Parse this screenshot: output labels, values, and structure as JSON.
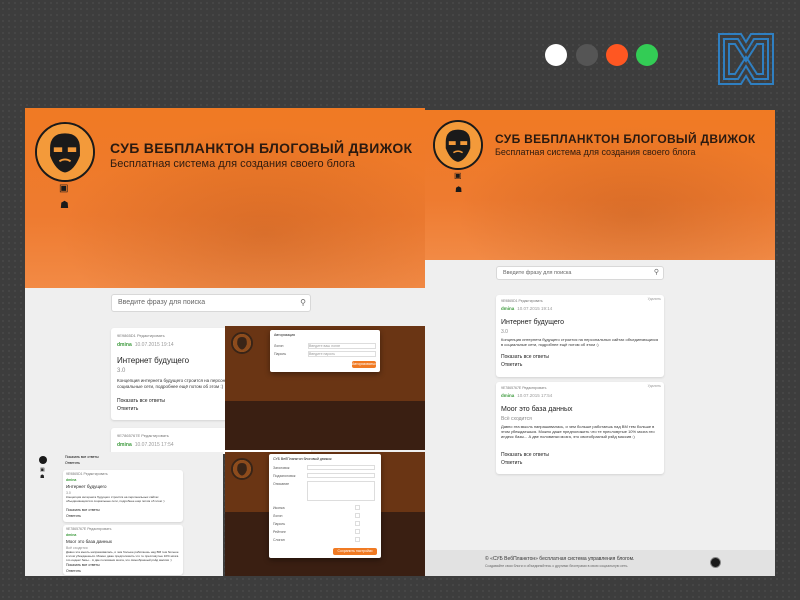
{
  "palette": {
    "colors": [
      "#ffffff",
      "#555555",
      "#ff5722",
      "#33cc55"
    ]
  },
  "blog": {
    "title": "СУБ ВЕБПЛАНКТОН БЛОГОВЫЙ ДВИЖОК",
    "subtitle": "Бесплатная система для создания своего блога",
    "search_placeholder": "Введите фразу для поиска",
    "search_icon": "search-icon",
    "nav_icons": [
      "book-icon",
      "user-icon"
    ],
    "posts": [
      {
        "meta": "9E9865D1 Редактировать",
        "author": "dmina",
        "date": "10.07.2015 19:14",
        "title": "Интернет будущего",
        "version": "3.0",
        "body": "Концепция интернета будущего строится на персональных сайтах объединяющихся в социальные сети, подробнее ещё потом об этом :)",
        "show_all": "Показать все ответы",
        "reply": "Ответить",
        "delete": "Удалить"
      },
      {
        "meta": "9E7865767E Редактировать",
        "author": "dmina",
        "date": "10.07.2015 17:54",
        "title": "Моог это база данных",
        "version": "Всё сходится",
        "body": "Давно эта мысль напрашивалась, и чем больше работаешь над ВМ тем больше в этом убеждаешься. Можно даже предположить что те пресловутые 10% мозга это индекс базы... А две половинки мозга, это своеобразный рэйд массив :)",
        "show_all": "Показать все ответы",
        "reply": "Ответить",
        "delete": "Удалить"
      }
    ],
    "footer": {
      "line1": "© «СУБ ВебПланктон» бесплатная система управления блогом.",
      "line2": "Создавайте свои блоги и объединяйтесь с другими блогерами в свою социальную сеть."
    }
  },
  "auth_modal": {
    "title": "Авторизация",
    "login_label": "Логин",
    "login_placeholder": "Введите ваш логин",
    "password_label": "Пароль",
    "password_placeholder": "Введите пароль",
    "submit": "Авторизоваться"
  },
  "settings_modal": {
    "title": "СУБ ВебПланктон блоговый движок",
    "fields": [
      "Заголовок",
      "Подзаголовок",
      "Описание",
      "Иконка",
      "Логин",
      "Пароль",
      "Рейтинг",
      "Слоган"
    ],
    "submit": "Сохранить настройки"
  },
  "mobile": {
    "top_snippet_1": "Показать все ответы",
    "top_snippet_2": "Ответить"
  }
}
